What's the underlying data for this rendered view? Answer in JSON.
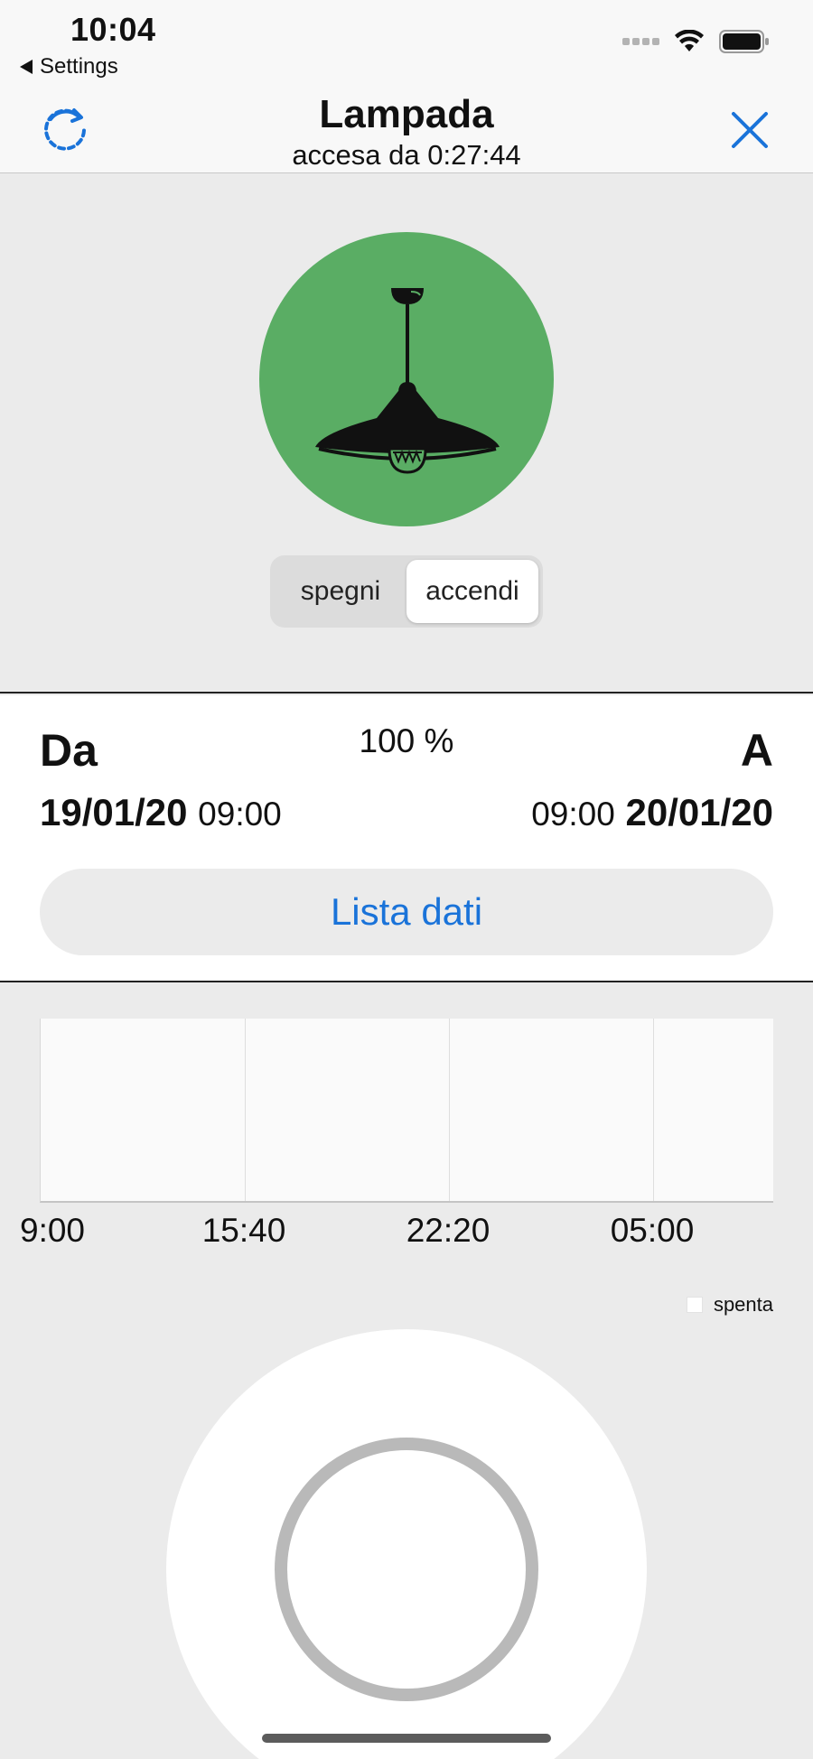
{
  "status_bar": {
    "time": "10:04",
    "back_label": "Settings",
    "icons": [
      "signal-dots-icon",
      "wifi-icon",
      "battery-icon"
    ]
  },
  "nav": {
    "title": "Lampada",
    "subtitle": "accesa da 0:27:44",
    "left_icon": "refresh-icon",
    "right_icon": "close-icon",
    "accent_color": "#1a73d9"
  },
  "lamp": {
    "icon": "pendant-lamp-icon",
    "status_color": "#5aad64",
    "segments": [
      {
        "label": "spegni",
        "selected": false
      },
      {
        "label": "accendi",
        "selected": true
      }
    ]
  },
  "range": {
    "from_label": "Da",
    "to_label": "A",
    "from_date": "19/01/20",
    "from_time": "09:00",
    "to_time": "09:00",
    "to_date": "20/01/20",
    "list_button_label": "Lista dati"
  },
  "chart_data": {
    "type": "area",
    "x_tick_labels": [
      "9:00",
      "15:40",
      "22:20",
      "05:00"
    ],
    "series": [
      {
        "name": "spenta",
        "values": []
      }
    ],
    "legend_placement": "bottom-right",
    "grid": true
  },
  "donut": {
    "type": "pie",
    "percent_label": "100 %",
    "value": 100
  }
}
